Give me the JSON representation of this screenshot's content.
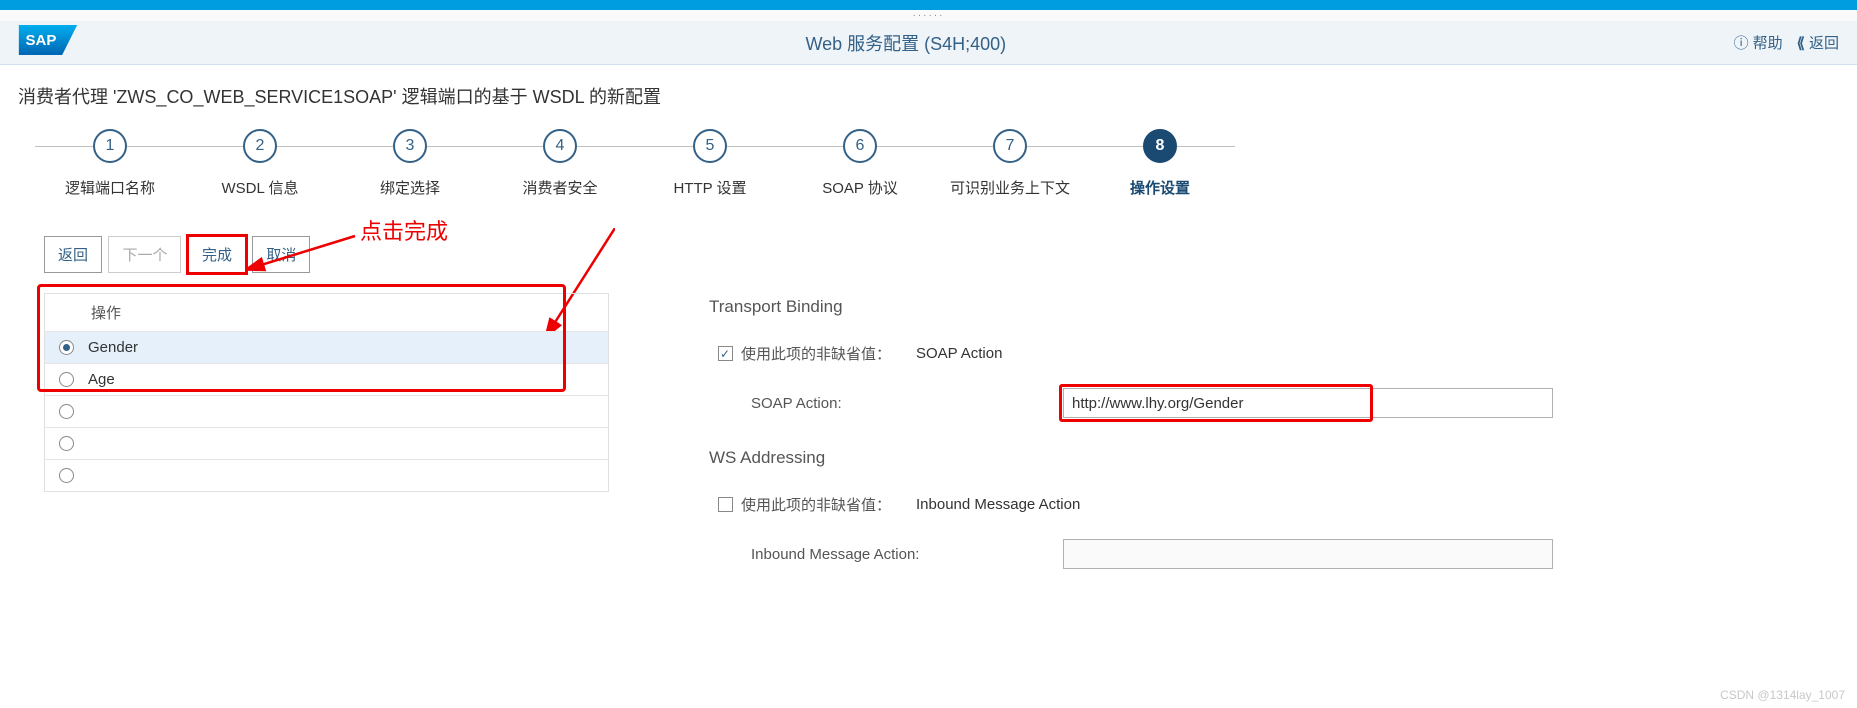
{
  "header": {
    "title": "Web 服务配置 (S4H;400)",
    "help": "帮助",
    "back": "返回"
  },
  "subtitle": "消费者代理 'ZWS_CO_WEB_SERVICE1SOAP' 逻辑端口的基于 WSDL 的新配置",
  "wizard": {
    "steps": [
      {
        "num": "1",
        "label": "逻辑端口名称"
      },
      {
        "num": "2",
        "label": "WSDL 信息"
      },
      {
        "num": "3",
        "label": "绑定选择"
      },
      {
        "num": "4",
        "label": "消费者安全"
      },
      {
        "num": "5",
        "label": "HTTP 设置"
      },
      {
        "num": "6",
        "label": "SOAP 协议"
      },
      {
        "num": "7",
        "label": "可识别业务上下文"
      },
      {
        "num": "8",
        "label": "操作设置"
      }
    ]
  },
  "annotation": {
    "text": "点击完成"
  },
  "toolbar": {
    "back": "返回",
    "next": "下一个",
    "finish": "完成",
    "cancel": "取消"
  },
  "ops": {
    "header": "操作",
    "items": [
      {
        "label": "Gender",
        "checked": true
      },
      {
        "label": "Age",
        "checked": false
      }
    ]
  },
  "transport": {
    "title": "Transport Binding",
    "use_non_default_label": "使用此项的非缺省值：",
    "soap_action_static": "SOAP Action",
    "soap_action_label": "SOAP Action:",
    "soap_action_value": "http://www.lhy.org/Gender"
  },
  "ws": {
    "title": "WS Addressing",
    "use_non_default_label": "使用此项的非缺省值：",
    "inbound_static": "Inbound Message Action",
    "inbound_label": "Inbound Message Action:"
  },
  "watermark": "CSDN @1314lay_1007"
}
